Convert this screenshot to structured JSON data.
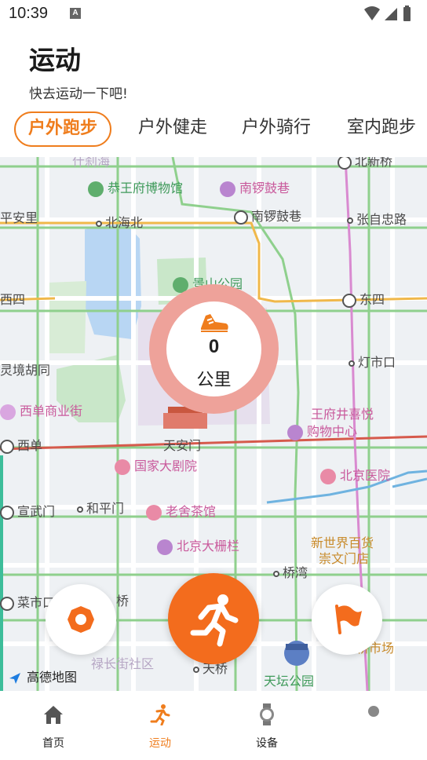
{
  "status_bar": {
    "time": "10:39",
    "notification_icon": "a-icon",
    "icons": [
      "wifi-icon",
      "signal-icon",
      "battery-icon"
    ]
  },
  "header": {
    "title": "运动",
    "subtitle": "快去运动一下吧!"
  },
  "tabs": [
    {
      "label": "户外跑步",
      "active": true
    },
    {
      "label": "户外健走",
      "active": false
    },
    {
      "label": "户外骑行",
      "active": false
    },
    {
      "label": "室内跑步",
      "active": false
    }
  ],
  "map": {
    "labels": {
      "shichahai": "什刹海",
      "beixinqiao": "北新桥",
      "gongwangfu": "恭王府博物馆",
      "nanluoguxiang_poi": "南锣鼓巷",
      "pinganli": "平安里",
      "beihaibei": "北海北",
      "nanluoguxiang_station": "南锣鼓巷",
      "zhangzizhonglu": "张自忠路",
      "jingshan": "景山公园",
      "xisi": "西四",
      "dongsi": "东四",
      "lingjinghutong": "灵境胡同",
      "dengshikou": "灯市口",
      "xidan_mall": "西单商业街",
      "wangfujing": "王府井喜悦",
      "wangfujing2": "购物中心",
      "xidan": "西单",
      "tiananmen": "天安门",
      "guojiadajuyuan": "国家大剧院",
      "beijingyiyuan": "北京医院",
      "xuanwumen": "宣武门",
      "hepingmen": "和平门",
      "laoshechaguan": "老舍茶馆",
      "xinshijie": "新世界百货",
      "chongwenmen": "崇文门店",
      "dashilan": "北京大栅栏",
      "qiaowan": "桥湾",
      "caishikou": "菜市口",
      "fangqiao": "桥",
      "shichang": "桥市场",
      "luchangjie": "禄长街社区",
      "tianqiao": "天桥",
      "tiantan": "天坛公园"
    },
    "logo_text": "高德地图"
  },
  "distance": {
    "value": "0",
    "unit": "公里"
  },
  "buttons": {
    "settings": "settings-icon",
    "start": "running-icon",
    "flag": "flag-icon"
  },
  "bottom_nav": [
    {
      "label": "首页",
      "icon": "home-icon",
      "active": false
    },
    {
      "label": "运动",
      "icon": "running-icon",
      "active": true
    },
    {
      "label": "设备",
      "icon": "watch-icon",
      "active": false
    },
    {
      "label": "",
      "icon": "profile-icon",
      "active": false
    }
  ],
  "colors": {
    "accent": "#ef7d1d",
    "start_button": "#f36c1d",
    "ring": "#eea29a"
  }
}
